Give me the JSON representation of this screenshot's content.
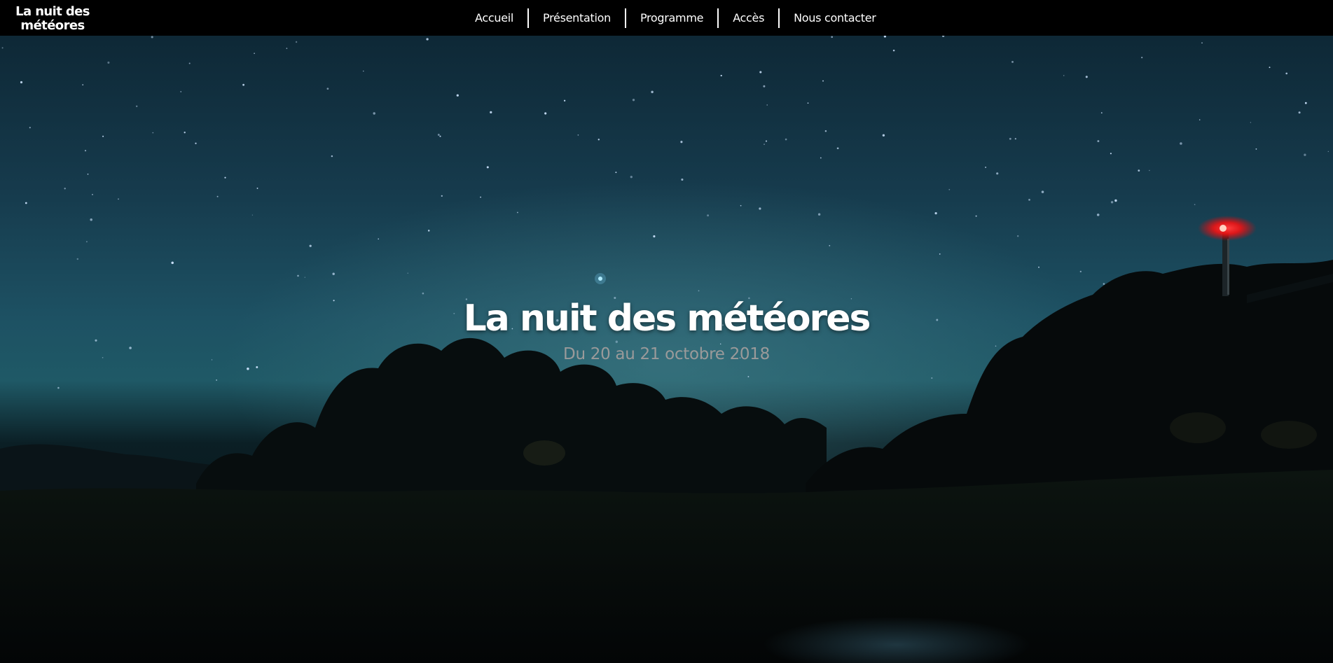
{
  "header": {
    "logo_line1": "La nuit des",
    "logo_line2": "météores"
  },
  "nav": {
    "items": [
      {
        "label": "Accueil"
      },
      {
        "label": "Présentation"
      },
      {
        "label": "Programme"
      },
      {
        "label": "Accès"
      },
      {
        "label": "Nous contacter"
      }
    ]
  },
  "hero": {
    "title": "La nuit des météores",
    "subtitle": "Du 20 au 21 octobre 2018"
  },
  "colors": {
    "nav_background": "#000000",
    "text": "#ffffff",
    "subtitle": "#9a9a9a",
    "beacon": "#ff1a1a"
  }
}
